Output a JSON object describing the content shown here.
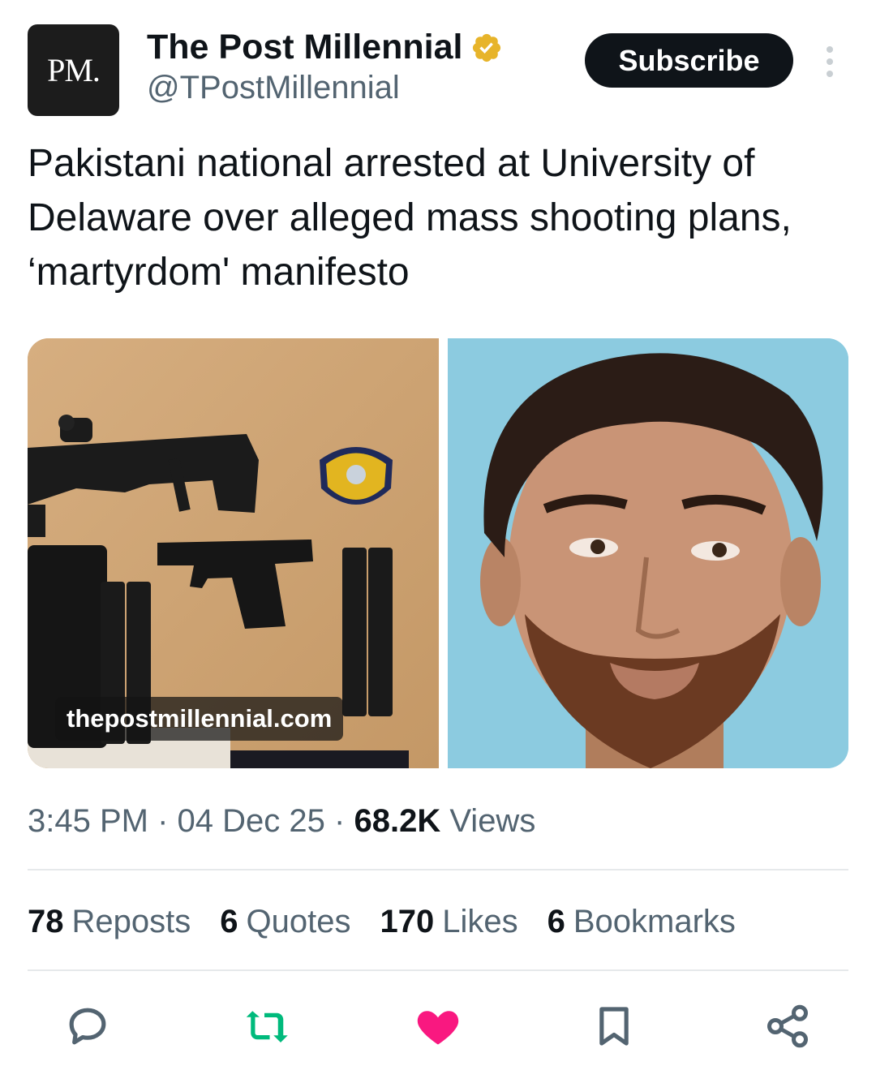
{
  "author": {
    "avatar_text": "PM.",
    "display_name": "The Post Millennial",
    "handle": "@TPostMillennial",
    "verified_color": "#e7b42a"
  },
  "header": {
    "subscribe_label": "Subscribe",
    "more_icon": "more-vertical-icon"
  },
  "tweet": {
    "text": "Pakistani national arrested at University of Delaware over alleged mass shooting plans, ‘martyrdom' manifesto",
    "media": {
      "watermark": "thepostmillennial.com"
    }
  },
  "meta": {
    "time": "3:45 PM",
    "sep1": "·",
    "date": "04 Dec 25",
    "sep2": "·",
    "views_count": "68.2K",
    "views_label": "Views"
  },
  "stats": [
    {
      "count": "78",
      "label": "Reposts"
    },
    {
      "count": "6",
      "label": "Quotes"
    },
    {
      "count": "170",
      "label": "Likes"
    },
    {
      "count": "6",
      "label": "Bookmarks"
    }
  ],
  "actions": [
    {
      "icon": "reply-icon",
      "color": "#536471"
    },
    {
      "icon": "repost-icon",
      "color": "#00ba7c"
    },
    {
      "icon": "like-icon",
      "color": "#f91880"
    },
    {
      "icon": "bookmark-icon",
      "color": "#536471"
    },
    {
      "icon": "share-icon",
      "color": "#536471"
    }
  ]
}
